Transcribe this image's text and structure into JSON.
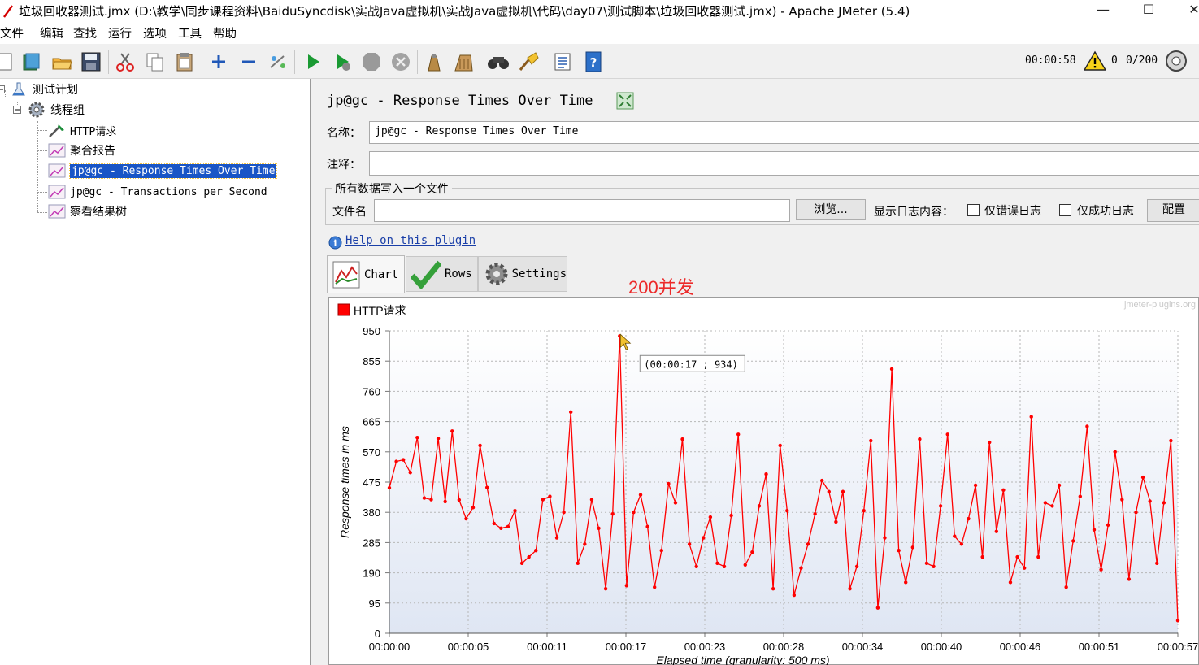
{
  "window": {
    "title": "垃圾回收器测试.jmx (D:\\教学\\同步课程资料\\BaiduSyncdisk\\实战Java虚拟机\\实战Java虚拟机\\代码\\day07\\测试脚本\\垃圾回收器测试.jmx) - Apache JMeter (5.4)",
    "minimize": "—",
    "maximize": "☐",
    "close": "✕"
  },
  "menubar": [
    "文件",
    "编辑",
    "查找",
    "运行",
    "选项",
    "工具",
    "帮助"
  ],
  "toolbar": {
    "elapsed": "00:00:58",
    "warnings": "0",
    "threads": "0/200"
  },
  "tree": {
    "root": "测试计划",
    "thread_group": "线程组",
    "items": [
      {
        "label": "HTTP请求",
        "icon": "sampler-icon"
      },
      {
        "label": "聚合报告",
        "icon": "listener-icon"
      },
      {
        "label": "jp@gc - Response Times Over Time",
        "icon": "listener-icon",
        "selected": true
      },
      {
        "label": "jp@gc - Transactions per Second",
        "icon": "listener-icon"
      },
      {
        "label": "察看结果树",
        "icon": "listener-icon"
      }
    ]
  },
  "panel": {
    "title": "jp@gc - Response Times Over Time",
    "name_label": "名称：",
    "name_value": "jp@gc - Response Times Over Time",
    "comment_label": "注释：",
    "comment_value": "",
    "file_group_title": "所有数据写入一个文件",
    "filename_label": "文件名",
    "filename_value": "",
    "browse_button": "浏览...",
    "log_content_label": "显示日志内容：",
    "errors_only_label": "仅错误日志",
    "success_only_label": "仅成功日志",
    "configure_button": "配置",
    "help_link": "Help on this plugin",
    "tabs": [
      "Chart",
      "Rows",
      "Settings"
    ],
    "annotation": "200并发"
  },
  "chart_data": {
    "type": "line",
    "watermark": "jmeter-plugins.org",
    "legend": [
      {
        "name": "HTTP请求",
        "color": "#ff0000"
      }
    ],
    "ylabel": "Response times in ms",
    "xlabel": "Elapsed time (granularity: 500 ms)",
    "ylim": [
      0,
      950
    ],
    "yticks": [
      "950",
      "855",
      "760",
      "665",
      "570",
      "475",
      "380",
      "285",
      "190",
      "95",
      "0"
    ],
    "xticks": [
      "00:00:00",
      "00:00:05",
      "00:00:11",
      "00:00:17",
      "00:00:23",
      "00:00:28",
      "00:00:34",
      "00:00:40",
      "00:00:46",
      "00:00:51",
      "00:00:57"
    ],
    "xlim_seconds": [
      0,
      57
    ],
    "tooltip": "(00:00:17 ; 934)",
    "series": [
      {
        "name": "HTTP请求",
        "color": "#ff0000",
        "values": [
          457,
          540,
          545,
          505,
          615,
          425,
          420,
          612,
          414,
          635,
          419,
          360,
          395,
          590,
          458,
          345,
          330,
          335,
          385,
          220,
          240,
          260,
          420,
          430,
          300,
          380,
          695,
          220,
          280,
          420,
          330,
          140,
          375,
          934,
          150,
          380,
          435,
          335,
          145,
          260,
          470,
          410,
          610,
          280,
          210,
          300,
          365,
          220,
          210,
          370,
          625,
          215,
          255,
          400,
          500,
          140,
          590,
          385,
          120,
          205,
          280,
          375,
          480,
          445,
          350,
          445,
          140,
          210,
          385,
          605,
          80,
          300,
          830,
          260,
          160,
          270,
          610,
          220,
          210,
          400,
          625,
          305,
          280,
          360,
          465,
          240,
          600,
          320,
          450,
          160,
          240,
          205,
          680,
          240,
          410,
          400,
          465,
          145,
          290,
          430,
          650,
          325,
          200,
          340,
          570,
          420,
          170,
          380,
          490,
          415,
          220,
          410,
          605,
          40
        ]
      }
    ]
  },
  "colors": {
    "selection": "#1955c6",
    "series": "#ff0000",
    "annotation": "#ec2a2a"
  }
}
